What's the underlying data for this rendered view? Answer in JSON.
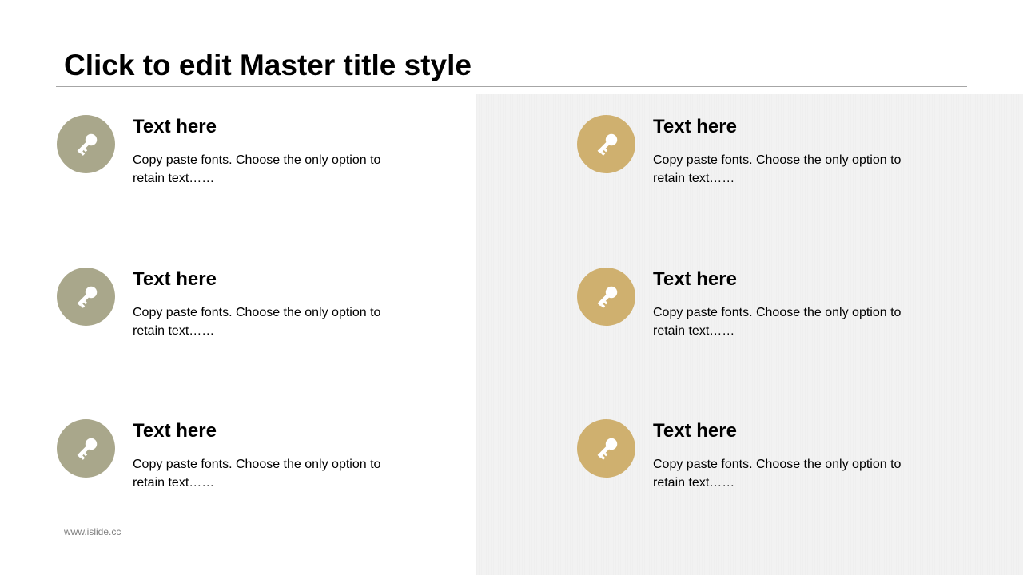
{
  "slide": {
    "title": "Click to edit Master title style",
    "footer_url": "www.islide.cc"
  },
  "colors": {
    "left_icon": "#a9a78b",
    "right_icon": "#cfb06f",
    "panel": "#f2f2f2",
    "rule": "#a6a6a6"
  },
  "items": [
    {
      "icon": "key-icon",
      "heading": "Text here",
      "text": "Copy paste fonts. Choose the only option to retain text……"
    },
    {
      "icon": "key-icon",
      "heading": "Text here",
      "text": "Copy paste fonts. Choose the only option to retain text……"
    },
    {
      "icon": "key-icon",
      "heading": "Text here",
      "text": "Copy paste fonts. Choose the only option to retain text……"
    },
    {
      "icon": "key-icon",
      "heading": "Text here",
      "text": "Copy paste fonts. Choose the only option to retain text……"
    },
    {
      "icon": "key-icon",
      "heading": "Text here",
      "text": "Copy paste fonts. Choose the only option to retain text……"
    },
    {
      "icon": "key-icon",
      "heading": "Text here",
      "text": "Copy paste fonts. Choose the only option to retain text……"
    }
  ]
}
